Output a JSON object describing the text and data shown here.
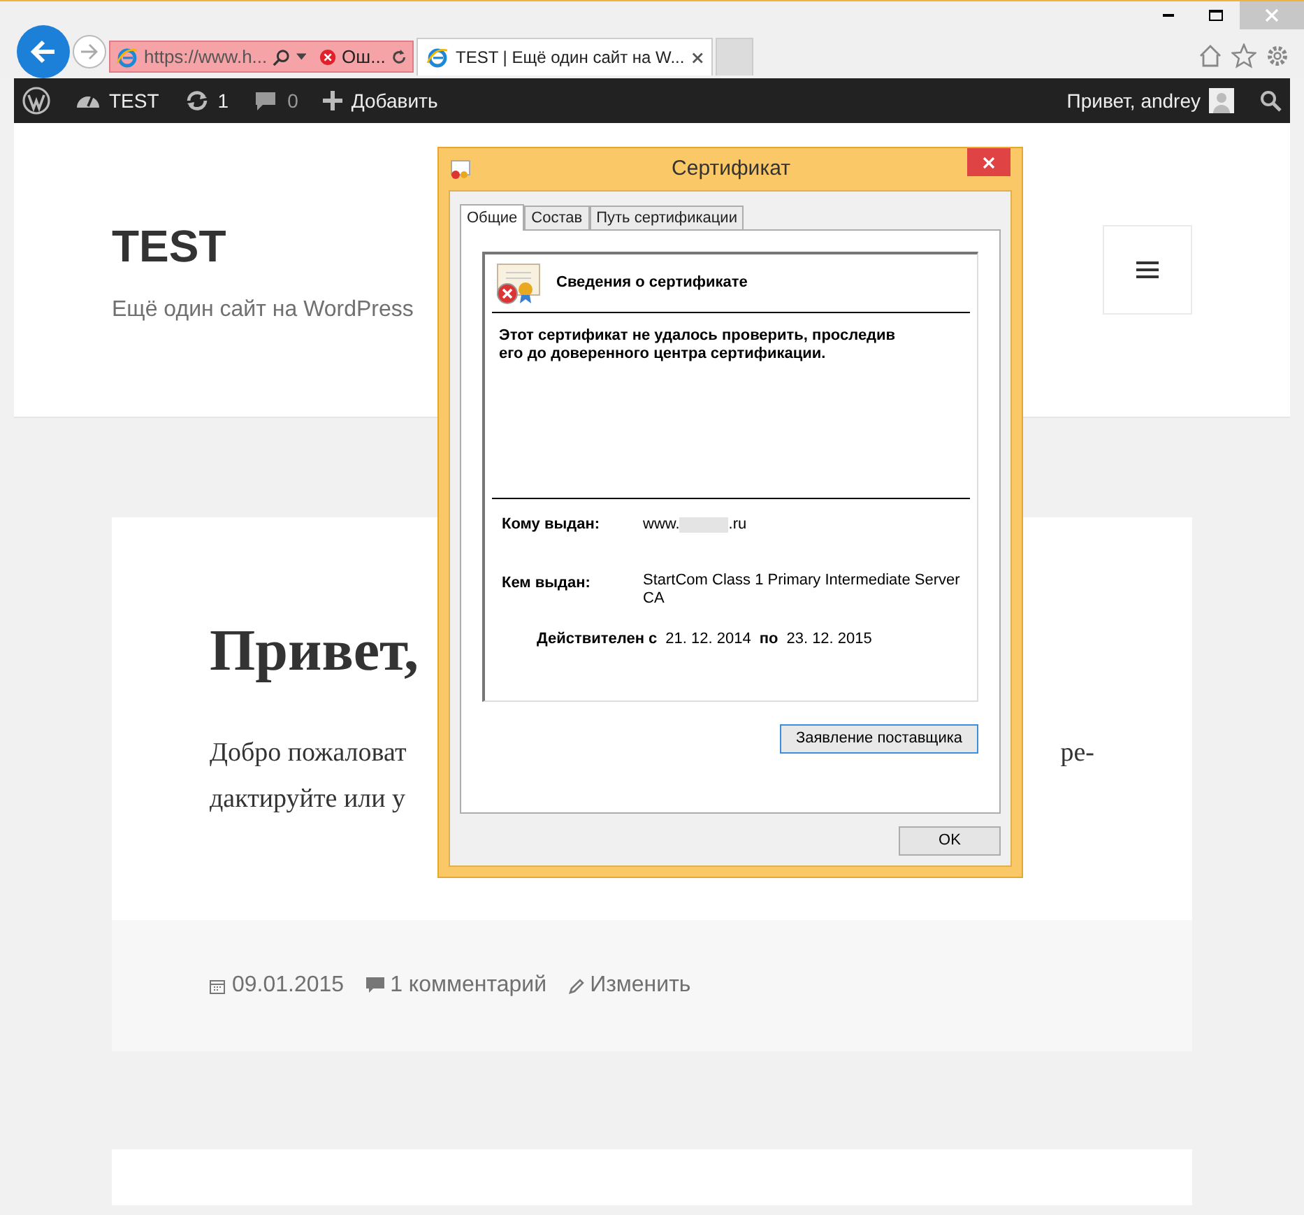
{
  "browser": {
    "address": "https://www.h...",
    "address_status": "Ош...",
    "tabs": [
      {
        "label": "TEST | Ещё один сайт на W...",
        "selected": true
      }
    ]
  },
  "admin_bar": {
    "site": "TEST",
    "updates": "1",
    "comments": "0",
    "add": "Добавить",
    "greeting": "Привет, andrey"
  },
  "site": {
    "title": "TEST",
    "tagline": "Ещё один сайт на WordPress"
  },
  "post": {
    "title": "Привет,",
    "body_line_1": "Добро пожаловат",
    "body_line_1_end": "ре-",
    "body_line_2": "дактируйте или у",
    "date": "09.01.2015",
    "comments": "1 комментарий",
    "edit": "Изменить"
  },
  "dialog": {
    "title": "Сертификат",
    "tabs": [
      {
        "label": "Общие",
        "selected": true
      },
      {
        "label": "Состав",
        "selected": false
      },
      {
        "label": "Путь сертификации",
        "selected": false
      }
    ],
    "heading": "Сведения о сертификате",
    "warning": "Этот сертификат не удалось проверить, проследив его до доверенного центра сертификации.",
    "issued_to_label": "Кому выдан:",
    "issued_to_prefix": "www.",
    "issued_to_suffix": ".ru",
    "issued_by_label": "Кем выдан:",
    "issued_by": "StartCom Class 1 Primary Intermediate Server CA",
    "valid_label": "Действителен с",
    "valid_from": "21. 12. 2014",
    "valid_to_label": "по",
    "valid_to": "23. 12. 2015",
    "statement_button": "Заявление поставщика",
    "ok_button": "OK"
  }
}
